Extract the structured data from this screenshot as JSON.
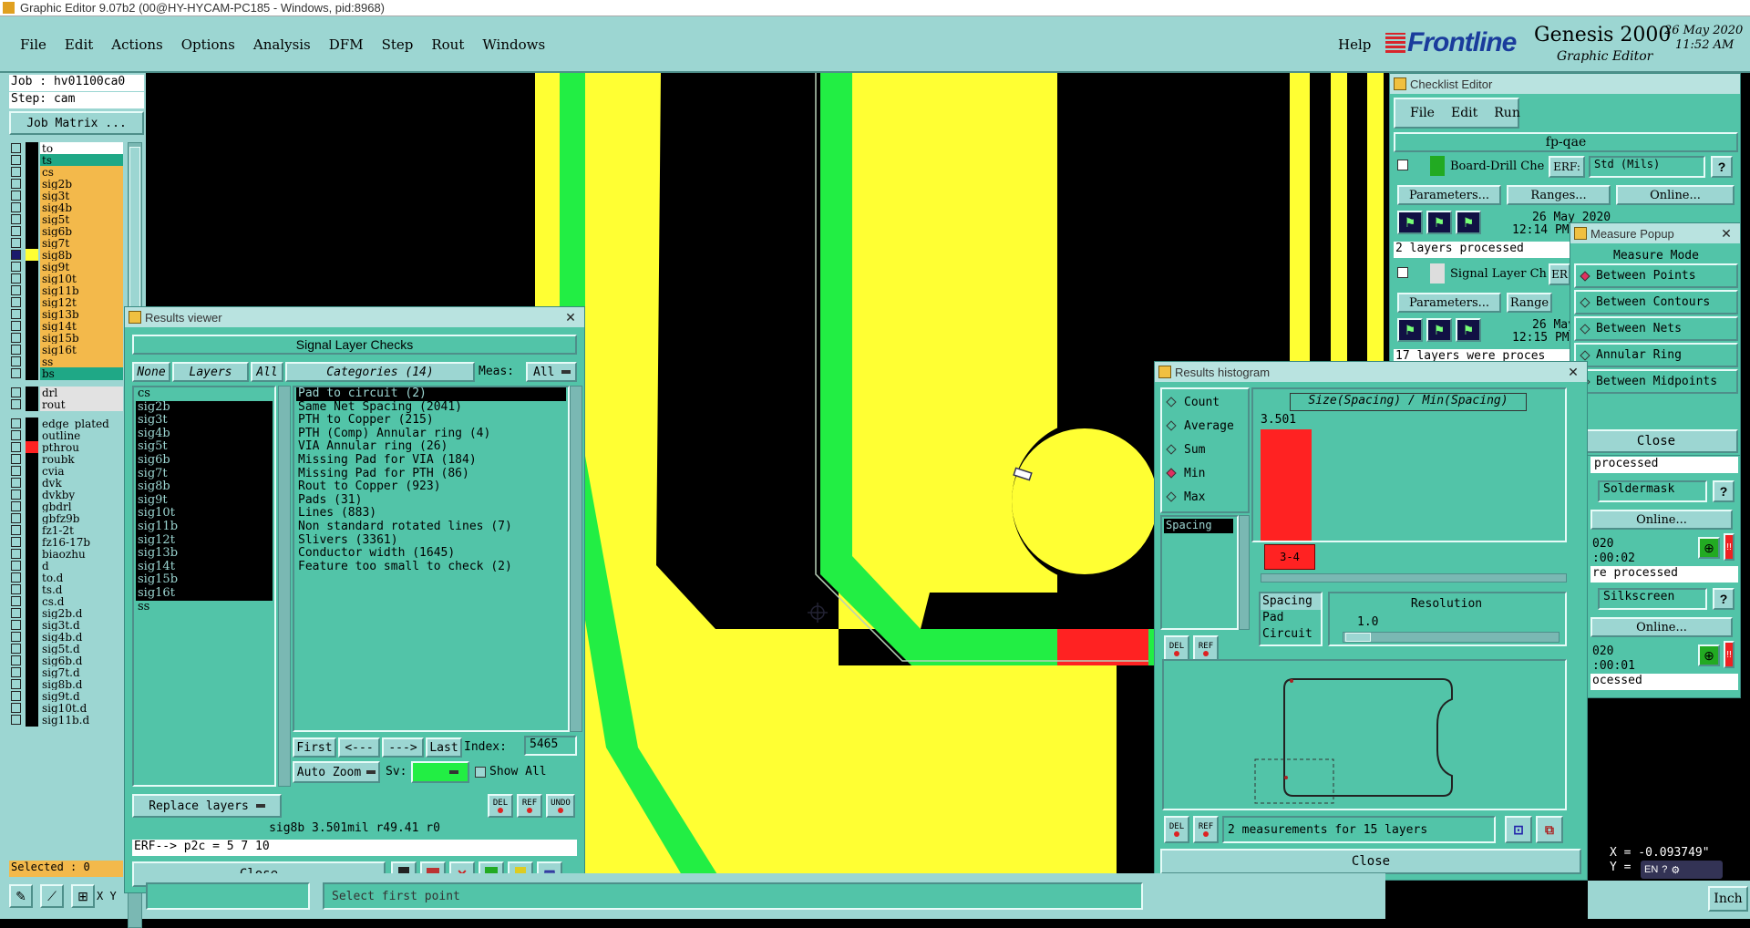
{
  "app_title": "Graphic Editor 9.07b2 (00@HY-HYCAM-PC185 - Windows, pid:8968)",
  "menu": [
    "File",
    "Edit",
    "Actions",
    "Options",
    "Analysis",
    "DFM",
    "Step",
    "Rout",
    "Windows"
  ],
  "help": "Help",
  "brand": {
    "logo": "Frontline",
    "product": "Genesis 2000",
    "subtitle": "Graphic Editor",
    "date": "26 May 2020",
    "time": "11:52 AM"
  },
  "job": {
    "job": "Job : hv01100ca0",
    "step": "Step: cam",
    "matrix_btn": "Job Matrix ..."
  },
  "layers": [
    {
      "name": "to",
      "color": "#ffffff"
    },
    {
      "name": "ts",
      "color": "#1fa886"
    },
    {
      "name": "cs",
      "color": "#f3b94b"
    },
    {
      "name": "sig2b",
      "color": "#f3b94b"
    },
    {
      "name": "sig3t",
      "color": "#f3b94b"
    },
    {
      "name": "sig4b",
      "color": "#f3b94b"
    },
    {
      "name": "sig5t",
      "color": "#f3b94b"
    },
    {
      "name": "sig6b",
      "color": "#f3b94b"
    },
    {
      "name": "sig7t",
      "color": "#f3b94b"
    },
    {
      "name": "sig8b",
      "color": "#f3b94b"
    },
    {
      "name": "sig9t",
      "color": "#f3b94b"
    },
    {
      "name": "sig10t",
      "color": "#f3b94b"
    },
    {
      "name": "sig11b",
      "color": "#f3b94b"
    },
    {
      "name": "sig12t",
      "color": "#f3b94b"
    },
    {
      "name": "sig13b",
      "color": "#f3b94b"
    },
    {
      "name": "sig14t",
      "color": "#f3b94b"
    },
    {
      "name": "sig15b",
      "color": "#f3b94b"
    },
    {
      "name": "sig16t",
      "color": "#f3b94b"
    },
    {
      "name": "ss",
      "color": "#f3b94b"
    },
    {
      "name": "bs",
      "color": "#1fa886"
    }
  ],
  "layers2": [
    "drl",
    "rout"
  ],
  "layers3": [
    "edge_plated",
    "outline",
    "pthrou",
    "roubk",
    "cvia",
    "dvk",
    "dvkby",
    "gbdrl",
    "gbfz9b",
    "fz1-2t",
    "fz16-17b",
    "biaozhu",
    "d",
    "to.d",
    "ts.d",
    "cs.d",
    "sig2b.d",
    "sig3t.d",
    "sig4b.d",
    "sig5t.d",
    "sig6b.d",
    "sig7t.d",
    "sig8b.d",
    "sig9t.d",
    "sig10t.d",
    "sig11b.d"
  ],
  "selected": "Selected : 0",
  "results_viewer": {
    "title": "Results viewer",
    "header": "Signal Layer Checks",
    "none": "None",
    "layers": "Layers",
    "all": "All",
    "categories": "Categories (14)",
    "meas_label": "Meas:",
    "meas_value": "All",
    "layer_list": [
      "cs",
      "sig2b",
      "sig3t",
      "sig4b",
      "sig5t",
      "sig6b",
      "sig7t",
      "sig8b",
      "sig9t",
      "sig10t",
      "sig11b",
      "sig12t",
      "sig13b",
      "sig14t",
      "sig15b",
      "sig16t",
      "ss"
    ],
    "category_list": [
      "Pad to circuit (2)",
      "Same Net Spacing (2041)",
      "PTH to Copper (215)",
      "PTH (Comp) Annular ring (4)",
      "VIA Annular ring (26)",
      "Missing Pad for VIA (184)",
      "Missing Pad for PTH (86)",
      "Rout to Copper (923)",
      "Pads (31)",
      "Lines (883)",
      "Non standard rotated lines (7)",
      "Slivers (3361)",
      "Conductor width (1645)",
      "Feature too small to check (2)"
    ],
    "first": "First",
    "prev": "<---",
    "next": "--->",
    "last": "Last",
    "index_label": "Index:",
    "index_value": "5465",
    "auto_zoom": "Auto Zoom",
    "sv": "Sv:",
    "show_all": "Show All",
    "replace": "Replace layers",
    "del": "DEL",
    "ref": "REF",
    "undo": "UNDO",
    "status": "sig8b 3.501mil  r49.41  r0",
    "erf": "ERF--> p2c = 5 7 10",
    "close": "Close"
  },
  "checklist": {
    "title": "Checklist Editor",
    "menu": [
      "File",
      "Edit",
      "Run"
    ],
    "name": "fp-qae",
    "checks": [
      {
        "name": "Board-Drill Che",
        "erf": "ERF:",
        "std": "Std (Mils)",
        "params": "Parameters...",
        "ranges": "Ranges...",
        "online": "Online...",
        "date": "26 May 2020",
        "time": "12:14 PM",
        "status": "2 layers processed"
      },
      {
        "name": "Signal Layer Ch",
        "erf": "ER",
        "params": "Parameters...",
        "ranges": "Range",
        "date": "26 May",
        "time": "12:15 PM",
        "status": "17 layers were proces"
      }
    ],
    "partial": [
      {
        "label": "processed"
      },
      {
        "label": "Soldermask",
        "online": "Online...",
        "date": "020",
        "time": ":00:02",
        "status": "re processed"
      },
      {
        "label": "Silkscreen",
        "online": "Online...",
        "date": "020",
        "time": ":00:01",
        "status": "ocessed"
      }
    ]
  },
  "measure": {
    "title": "Measure Popup",
    "mode": "Measure Mode",
    "options": [
      "Between Points",
      "Between Contours",
      "Between Nets",
      "Annular Ring",
      "Between Midpoints"
    ],
    "selected": 0,
    "close": "Close"
  },
  "histogram": {
    "title": "Results histogram",
    "stats": [
      "Count",
      "Average",
      "Sum",
      "Min",
      "Max"
    ],
    "selected": 3,
    "size_label": "Size(Spacing) / Min(Spacing)",
    "bar1_value": "3.501",
    "bar2_label": "3-4",
    "list_item": "Spacing",
    "legend": [
      "Spacing",
      "Pad",
      "Circuit"
    ],
    "resolution_label": "Resolution",
    "resolution_value": "1.0",
    "del": "DEL",
    "ref": "REF",
    "measure_status": "2 measurements for 15 layers",
    "close": "Close"
  },
  "bottom": {
    "xy_label": "X Y",
    "prompt": "Select first point",
    "coords_x": "X = -0.093749\"",
    "coords_y": "Y =",
    "units": "Inch",
    "ime": "EN"
  },
  "colors": {
    "teal": "#9cd6d2",
    "dark_teal": "#52c4a8",
    "yellow": "#ffff33",
    "green": "#22ee44",
    "red": "#ff2222",
    "layer_orange": "#f3b94b"
  }
}
